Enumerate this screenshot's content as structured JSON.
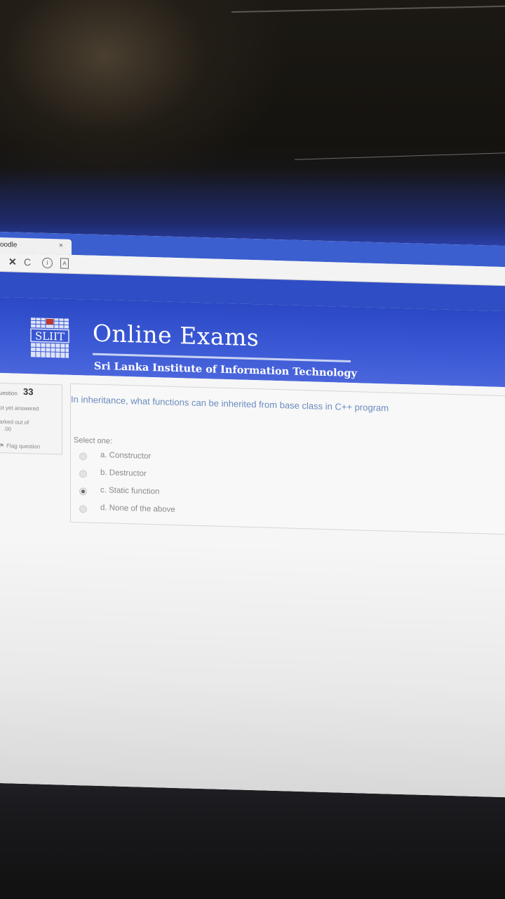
{
  "browser": {
    "tab_title": "oodle",
    "tab_close": "×",
    "toolbar": {
      "stop": "✕",
      "reload": "C",
      "info": "i",
      "page": "A"
    }
  },
  "header": {
    "logo_text": "SLIIT",
    "title": "Online Exams",
    "subtitle": "Sri Lanka Institute of Information Technology"
  },
  "question_info": {
    "label": "uestion",
    "number": "33",
    "state": "ot yet answered",
    "marked_line1": "arked out of",
    "marked_line2": ".00",
    "flag_label": "Flag question"
  },
  "question": {
    "text": "In inheritance, what functions can be inherited from base class in C++ program",
    "select_prompt": "Select one:",
    "options": [
      {
        "label": "a. Constructor",
        "selected": false
      },
      {
        "label": "b. Destructor",
        "selected": false
      },
      {
        "label": "c. Static function",
        "selected": true
      },
      {
        "label": "d. None of the above",
        "selected": false
      }
    ]
  },
  "colors": {
    "header_blue": "#3c5ad6",
    "question_text": "#6a8bbf"
  }
}
